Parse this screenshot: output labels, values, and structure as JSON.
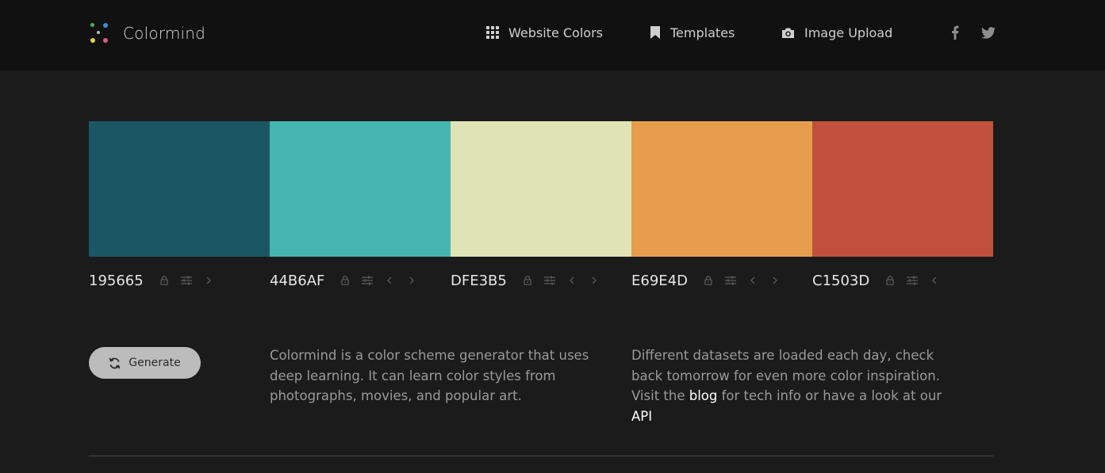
{
  "header": {
    "brand": "Colormind",
    "nav": [
      {
        "label": "Website Colors",
        "icon": "grid-icon"
      },
      {
        "label": "Templates",
        "icon": "bookmark-icon"
      },
      {
        "label": "Image Upload",
        "icon": "camera-icon"
      }
    ],
    "social": [
      "facebook-icon",
      "twitter-icon"
    ]
  },
  "palette": [
    {
      "hex": "195665",
      "color": "#1b5665"
    },
    {
      "hex": "44B6AF",
      "color": "#44b6af"
    },
    {
      "hex": "DFE3B5",
      "color": "#dfe3b5"
    },
    {
      "hex": "E69E4D",
      "color": "#e69e4d"
    },
    {
      "hex": "C1503D",
      "color": "#c1503d"
    }
  ],
  "generate": {
    "label": "Generate"
  },
  "about": {
    "text": "Colormind is a color scheme generator that uses deep learning. It can learn color styles from photographs, movies, and popular art."
  },
  "datasets": {
    "text_before": "Different datasets are loaded each day, check back tomorrow for even more color inspiration. Visit the",
    "blog_link": "blog",
    "text_middle": "for tech info or have a look at our",
    "api_link": "API"
  }
}
